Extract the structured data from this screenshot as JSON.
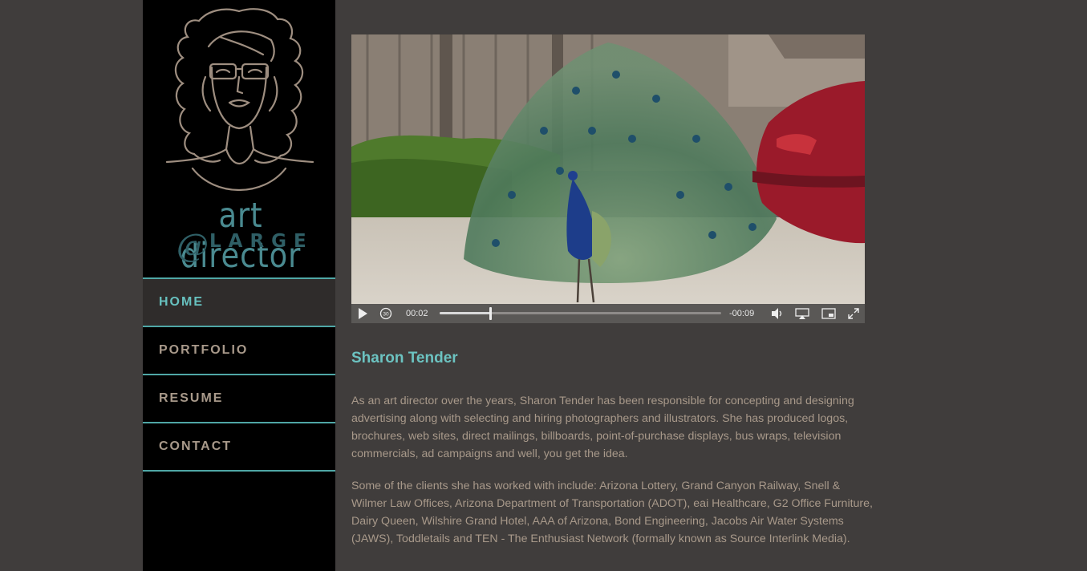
{
  "logo": {
    "line1": "art director",
    "at": "@",
    "line2": "LARGE"
  },
  "nav": {
    "items": [
      {
        "label": "HOME",
        "active": true
      },
      {
        "label": "PORTFOLIO",
        "active": false
      },
      {
        "label": "RESUME",
        "active": false
      },
      {
        "label": "CONTACT",
        "active": false
      }
    ]
  },
  "video": {
    "current_time": "00:02",
    "remaining_time": "-00:09",
    "progress": 0.18,
    "icons": [
      "play-icon",
      "replay-30-icon",
      "volume-icon",
      "airplay-icon",
      "picture-in-picture-icon",
      "fullscreen-icon"
    ]
  },
  "profile": {
    "name": "Sharon Tender",
    "paragraph1": "As an art director over the years, Sharon Tender has been responsible for concepting and designing advertising along with selecting and hiring photographers and illustrators. She has produced logos, brochures, web sites, direct mailings, billboards, point-of-purchase displays, bus wraps, television commercials, ad campaigns and well, you get the idea.",
    "paragraph2": "Some of the clients she has worked with include: Arizona Lottery, Grand Canyon Railway, Snell & Wilmer Law Offices, Arizona Department of Transportation (ADOT), eai Healthcare, G2 Office Furniture, Dairy Queen, Wilshire Grand Hotel, AAA of Arizona, Bond Engineering, Jacobs Air Water Systems (JAWS), Toddletails and TEN - The Enthusiast Network (formally known as Source Interlink Media)."
  },
  "colors": {
    "accent": "#6cc3c1",
    "nav_border": "#4fa7a6",
    "text": "#a8998a",
    "background": "#403d3c"
  }
}
